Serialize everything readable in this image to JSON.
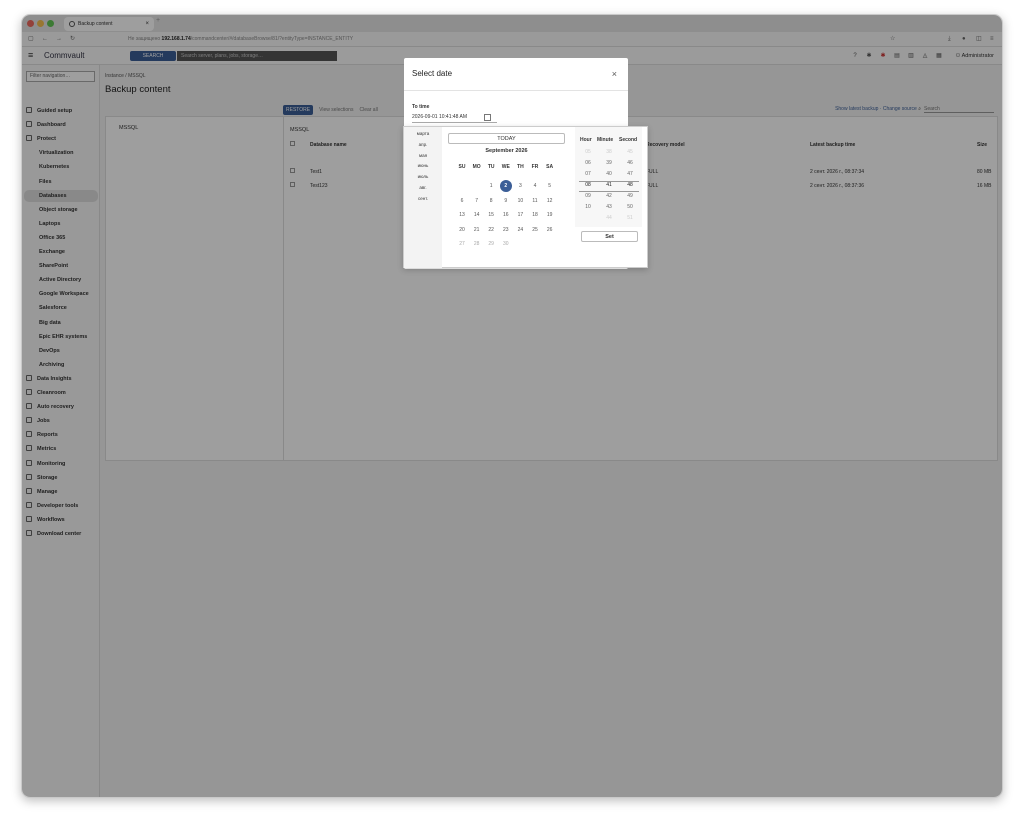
{
  "browser": {
    "tab_title": "Backup content",
    "not_secure": "Не защищено",
    "url_host": "192.168.1.74",
    "url_path": "/commandcenter/#/databaseBrowse/81/?entityType=INSTANCE_ENTITY"
  },
  "header": {
    "logo": "Commvault",
    "search_button": "SEARCH",
    "search_placeholder": "Search server, plans, jobs, storage…",
    "user": "Administrator"
  },
  "sidebar": {
    "filter_placeholder": "Filter navigation…",
    "items": [
      {
        "label": "Guided setup",
        "sub": false
      },
      {
        "label": "Dashboard",
        "sub": false
      },
      {
        "label": "Protect",
        "sub": false
      },
      {
        "label": "Virtualization",
        "sub": true
      },
      {
        "label": "Kubernetes",
        "sub": true
      },
      {
        "label": "Files",
        "sub": true
      },
      {
        "label": "Databases",
        "sub": true,
        "selected": true
      },
      {
        "label": "Object storage",
        "sub": true
      },
      {
        "label": "Laptops",
        "sub": true
      },
      {
        "label": "Office 365",
        "sub": true
      },
      {
        "label": "Exchange",
        "sub": true
      },
      {
        "label": "SharePoint",
        "sub": true
      },
      {
        "label": "Active Directory",
        "sub": true
      },
      {
        "label": "Google Workspace",
        "sub": true
      },
      {
        "label": "Salesforce",
        "sub": true
      },
      {
        "label": "Big data",
        "sub": true
      },
      {
        "label": "Epic EHR systems",
        "sub": true
      },
      {
        "label": "DevOps",
        "sub": true
      },
      {
        "label": "Archiving",
        "sub": true
      },
      {
        "label": "Data Insights",
        "sub": false
      },
      {
        "label": "Cleanroom",
        "sub": false
      },
      {
        "label": "Auto recovery",
        "sub": false
      },
      {
        "label": "Jobs",
        "sub": false
      },
      {
        "label": "Reports",
        "sub": false
      },
      {
        "label": "Metrics",
        "sub": false
      },
      {
        "label": "Monitoring",
        "sub": false
      },
      {
        "label": "Storage",
        "sub": false
      },
      {
        "label": "Manage",
        "sub": false
      },
      {
        "label": "Developer tools",
        "sub": false
      },
      {
        "label": "Workflows",
        "sub": false
      },
      {
        "label": "Download center",
        "sub": false
      }
    ]
  },
  "main": {
    "breadcrumb": "Instance / MSSQL",
    "title": "Backup content",
    "left_label": "MSSQL",
    "table_header": "MSSQL",
    "toolbar": {
      "restore": "RESTORE",
      "view_selections": "View selections",
      "clear_all": "Clear all"
    },
    "right_tools": {
      "show_latest": "Show latest backup",
      "change_source": "Change source",
      "search_placeholder": "Search"
    },
    "columns": {
      "name": "Database name",
      "recovery": "Recovery model",
      "latest": "Latest backup time",
      "size": "Size"
    },
    "rows": [
      {
        "name": "Test1",
        "recovery": "FULL",
        "latest": "2 сент. 2026 г., 08:37:34",
        "size": "80 MB"
      },
      {
        "name": "Test123",
        "recovery": "FULL",
        "latest": "2 сент. 2026 г., 08:37:36",
        "size": "16 MB"
      }
    ]
  },
  "dialog": {
    "title": "Select date",
    "to_time_label": "To time",
    "to_time_value": "2026-09-01 10:41:48 AM"
  },
  "picker": {
    "months": [
      "марта",
      "апр.",
      "мая",
      "июнь",
      "июль",
      "авг.",
      "сент."
    ],
    "today_button": "TODAY",
    "month_title": "September 2026",
    "weekdays": [
      "SU",
      "MO",
      "TU",
      "WE",
      "TH",
      "FR",
      "SA"
    ],
    "weeks": [
      [
        "",
        "",
        "1",
        "2",
        "3",
        "4",
        "5"
      ],
      [
        "6",
        "7",
        "8",
        "9",
        "10",
        "11",
        "12"
      ],
      [
        "13",
        "14",
        "15",
        "16",
        "17",
        "18",
        "19"
      ],
      [
        "20",
        "21",
        "22",
        "23",
        "24",
        "25",
        "26"
      ],
      [
        "27",
        "28",
        "29",
        "30",
        "",
        "",
        ""
      ]
    ],
    "selected_day": "2",
    "time_headers": [
      "Hour",
      "Minute",
      "Second"
    ],
    "hours": [
      "05",
      "06",
      "07",
      "08",
      "09",
      "10",
      ""
    ],
    "minutes": [
      "38",
      "39",
      "40",
      "41",
      "42",
      "43",
      "44"
    ],
    "seconds": [
      "45",
      "46",
      "47",
      "48",
      "49",
      "50",
      "51"
    ],
    "set_button": "Set"
  }
}
